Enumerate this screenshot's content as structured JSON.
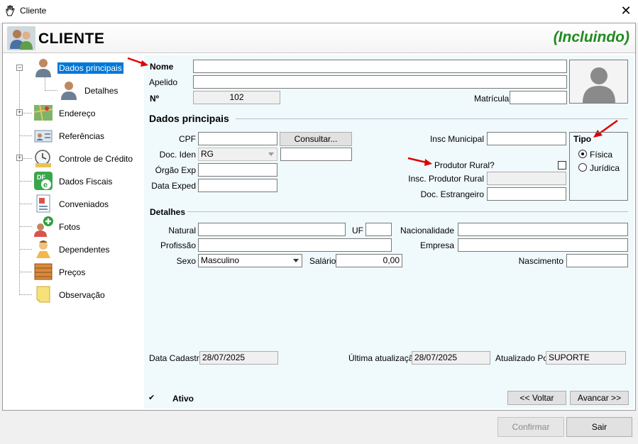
{
  "window": {
    "title": "Cliente"
  },
  "header": {
    "title": "CLIENTE",
    "mode": "(Incluindo)"
  },
  "tree": {
    "items": [
      {
        "label": "Dados principais"
      },
      {
        "label": "Detalhes"
      },
      {
        "label": "Endereço"
      },
      {
        "label": "Referências"
      },
      {
        "label": "Controle de Crédito"
      },
      {
        "label": "Dados Fiscais"
      },
      {
        "label": "Conveniados"
      },
      {
        "label": "Fotos"
      },
      {
        "label": "Dependentes"
      },
      {
        "label": "Preços"
      },
      {
        "label": "Observação"
      }
    ]
  },
  "form": {
    "nome_label": "Nome",
    "apelido_label": "Apelido",
    "numero_label": "Nº",
    "numero_value": "102",
    "matricula_label": "Matrícula",
    "section_dados": "Dados principais",
    "cpf_label": "CPF",
    "consultar_label": "Consultar...",
    "insc_municipal_label": "Insc Municipal",
    "tipo_label": "Tipo",
    "tipo_fisica": "Física",
    "tipo_juridica": "Jurídica",
    "doc_iden_label": "Doc. Iden",
    "doc_iden_value": "RG",
    "orgao_exp_label": "Órgão Exp",
    "data_exped_label": "Data Exped",
    "produtor_rural_label": "Produtor Rural?",
    "insc_produtor_label": "Insc. Produtor Rural",
    "doc_estrangeiro_label": "Doc. Estrangeiro",
    "section_detalhes": "Detalhes",
    "natural_label": "Natural",
    "uf_label": "UF",
    "nacionalidade_label": "Nacionalidade",
    "profissao_label": "Profissão",
    "empresa_label": "Empresa",
    "sexo_label": "Sexo",
    "sexo_value": "Masculino",
    "salario_label": "Salário",
    "salario_value": "0,00",
    "nascimento_label": "Nascimento",
    "data_cadastro_label": "Data Cadastro",
    "data_cadastro_value": "28/07/2025",
    "ultima_atualizacao_label": "Última atualização",
    "ultima_atualizacao_value": "28/07/2025",
    "atualizado_por_label": "Atualizado Por",
    "atualizado_por_value": "SUPORTE",
    "ativo_label": "Ativo",
    "voltar_label": "<< Voltar",
    "avancar_label": "Avancar >>"
  },
  "footer": {
    "confirmar_label": "Confirmar",
    "sair_label": "Sair"
  },
  "colors": {
    "mode_green": "#1f8a1f",
    "selected_blue": "#0078d7",
    "content_bg": "#f0f9fc",
    "arrow_red": "#e00000"
  }
}
